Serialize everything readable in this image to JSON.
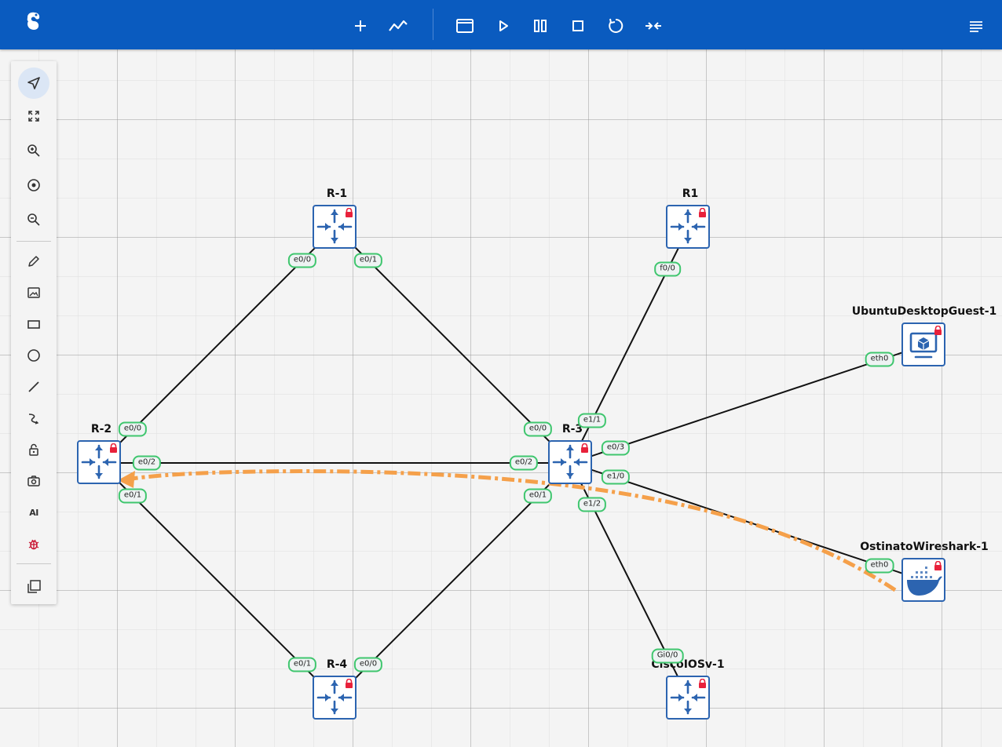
{
  "nodes": [
    {
      "id": "r-1",
      "label": "R-1",
      "kind": "router"
    },
    {
      "id": "r1",
      "label": "R1",
      "kind": "router"
    },
    {
      "id": "r-2",
      "label": "R-2",
      "kind": "router"
    },
    {
      "id": "r-3",
      "label": "R-3",
      "kind": "router"
    },
    {
      "id": "r-4",
      "label": "R-4",
      "kind": "router"
    },
    {
      "id": "ios",
      "label": "CiscoIOSv-1",
      "kind": "router"
    },
    {
      "id": "ubuntu",
      "label": "UbuntuDesktopGuest-1",
      "kind": "vm"
    },
    {
      "id": "ostinato",
      "label": "OstinatoWireshark-1",
      "kind": "docker"
    }
  ],
  "ports": {
    "r1_e00": "e0/0",
    "r1_e01": "e0/1",
    "rr1_f00": "f0/0",
    "r2_e00": "e0/0",
    "r2_e02": "e0/2",
    "r2_e01": "e0/1",
    "r3_e00": "e0/0",
    "r3_e02": "e0/2",
    "r3_e01": "e0/1",
    "r3_e11": "e1/1",
    "r3_e03": "e0/3",
    "r3_e10": "e1/0",
    "r3_e12": "e1/2",
    "r4_e01": "e0/1",
    "r4_e00": "e0/0",
    "ios_gi00": "Gi0/0",
    "ubuntu_eth0": "eth0",
    "ostinato_eth0": "eth0"
  },
  "toolbar": {
    "icons": [
      "logo-icon",
      "add-node-icon",
      "show-links-icon",
      "console-icon",
      "start-icon",
      "suspend-icon",
      "stop-icon",
      "reload-icon",
      "collapse-icon",
      "menu-icon"
    ]
  },
  "sidebar": {
    "tools": [
      "select-icon",
      "fit-screen-icon",
      "zoom-in-icon",
      "center-icon",
      "zoom-out-icon",
      "draw-icon",
      "image-icon",
      "rectangle-icon",
      "ellipse-icon",
      "line-icon",
      "curve-icon",
      "lock-icon",
      "screenshot-icon",
      "ai-icon",
      "debug-icon",
      "layers-icon"
    ],
    "ai_label": "AI"
  },
  "colors": {
    "topbar": "#0a5bbf",
    "node_border": "#2c64b0",
    "port_border": "#3fc66e",
    "lock": "#e8213b",
    "annotation": "#f5a04a"
  }
}
